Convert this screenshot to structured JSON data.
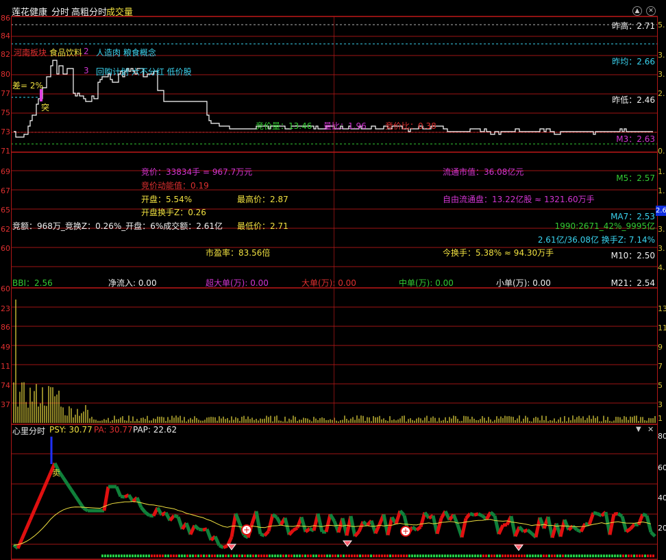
{
  "title": {
    "stock_name": "莲花健康",
    "view": "分时",
    "theme": "高粗分时",
    "indicator": "成交量"
  },
  "price_panel": {
    "left_ticks": [
      "86",
      "84",
      "82",
      "80",
      "77",
      "75",
      "73",
      "71"
    ],
    "right_ticks": [
      "5.",
      "3.",
      "3.",
      "2.",
      "0."
    ],
    "prev_high": "昨高：2.71",
    "prev_avg": "昨均：2.66",
    "prev_low": "昨低：2.46",
    "m3": "M3：2.63",
    "tags": [
      "河南板块",
      "食品饮料",
      "2",
      "人造肉 粮食概念",
      "3",
      "回购计划 六不分红 低价股"
    ],
    "diff_label": "差= 2%",
    "tu": "突",
    "stats_line": [
      {
        "label": "竞价量：13.46",
        "color": "#33cc33"
      },
      {
        "label": "量比：1.96",
        "color": "#d235d2"
      },
      {
        "label": "竞价比：0.38",
        "color": "#e03030"
      }
    ]
  },
  "info_panel": {
    "left_ticks": [
      "69",
      "67",
      "65",
      "62",
      "60"
    ],
    "right_ticks": [
      "1.",
      "1.",
      "3.",
      "3.",
      "4."
    ],
    "auction_price": "竞价：33834手 = 967.7万元",
    "auction_energy": "竞价动能值：0.19",
    "open_pct": "开盘：5.54%",
    "high_price": "最高价：2.87",
    "open_turnover": "开盘换手Z：0.26",
    "auction_amount": "竞额：968万_竞换Z：0.26%_开盘：6%成交额：2.61亿",
    "low_price": "最低价：2.71",
    "pe": "市盈率：83.56倍",
    "float_cap": "流通市值：36.08亿元",
    "free_float": "自由流通盘：13.22亿股 ≈ 1321.60万手",
    "turnover_today": "今换手：5.38% ≈ 94.30万手",
    "m5": "M5：2.57",
    "ma7": "MA7：2.53",
    "line1990": "1990:2671_42%_9995亿",
    "amount_ratio": "2.61亿/36.08亿 换手Z: 7.14%",
    "m10": "M10：2.50",
    "price_tag": "2.6"
  },
  "flow_bar": {
    "bbi": "BBI：2.56",
    "net_inflow": "净流入: 0.00",
    "xl": "超大单(万): 0.00",
    "l": "大单(万): 0.00",
    "m": "中单(万): 0.00",
    "s": "小单(万): 0.00",
    "m21": "M21：2.54"
  },
  "volume_panel": {
    "left_ticks": [
      "60",
      "23",
      "86",
      "49",
      "11",
      "74",
      "37"
    ],
    "right_ticks": [
      "13",
      "11",
      "9",
      "7",
      "5",
      "3",
      "1"
    ]
  },
  "psy_panel": {
    "name": "心里分时",
    "psy": "PSY: 30.77",
    "pa": "PA: 30.77",
    "pap": "PAP: 22.62",
    "sell_label": "卖",
    "right_ticks": [
      "80",
      "60",
      "40",
      "20"
    ]
  },
  "colors": {
    "up": "#e01010",
    "down": "#10803a",
    "grid": "#b01818",
    "yellow": "#f0e040",
    "cyan": "#3ad4f0",
    "green": "#33cc33",
    "magenta": "#d235d2"
  },
  "icons": [
    "up-arrow-icon",
    "close-icon",
    "dropdown-icon"
  ]
}
